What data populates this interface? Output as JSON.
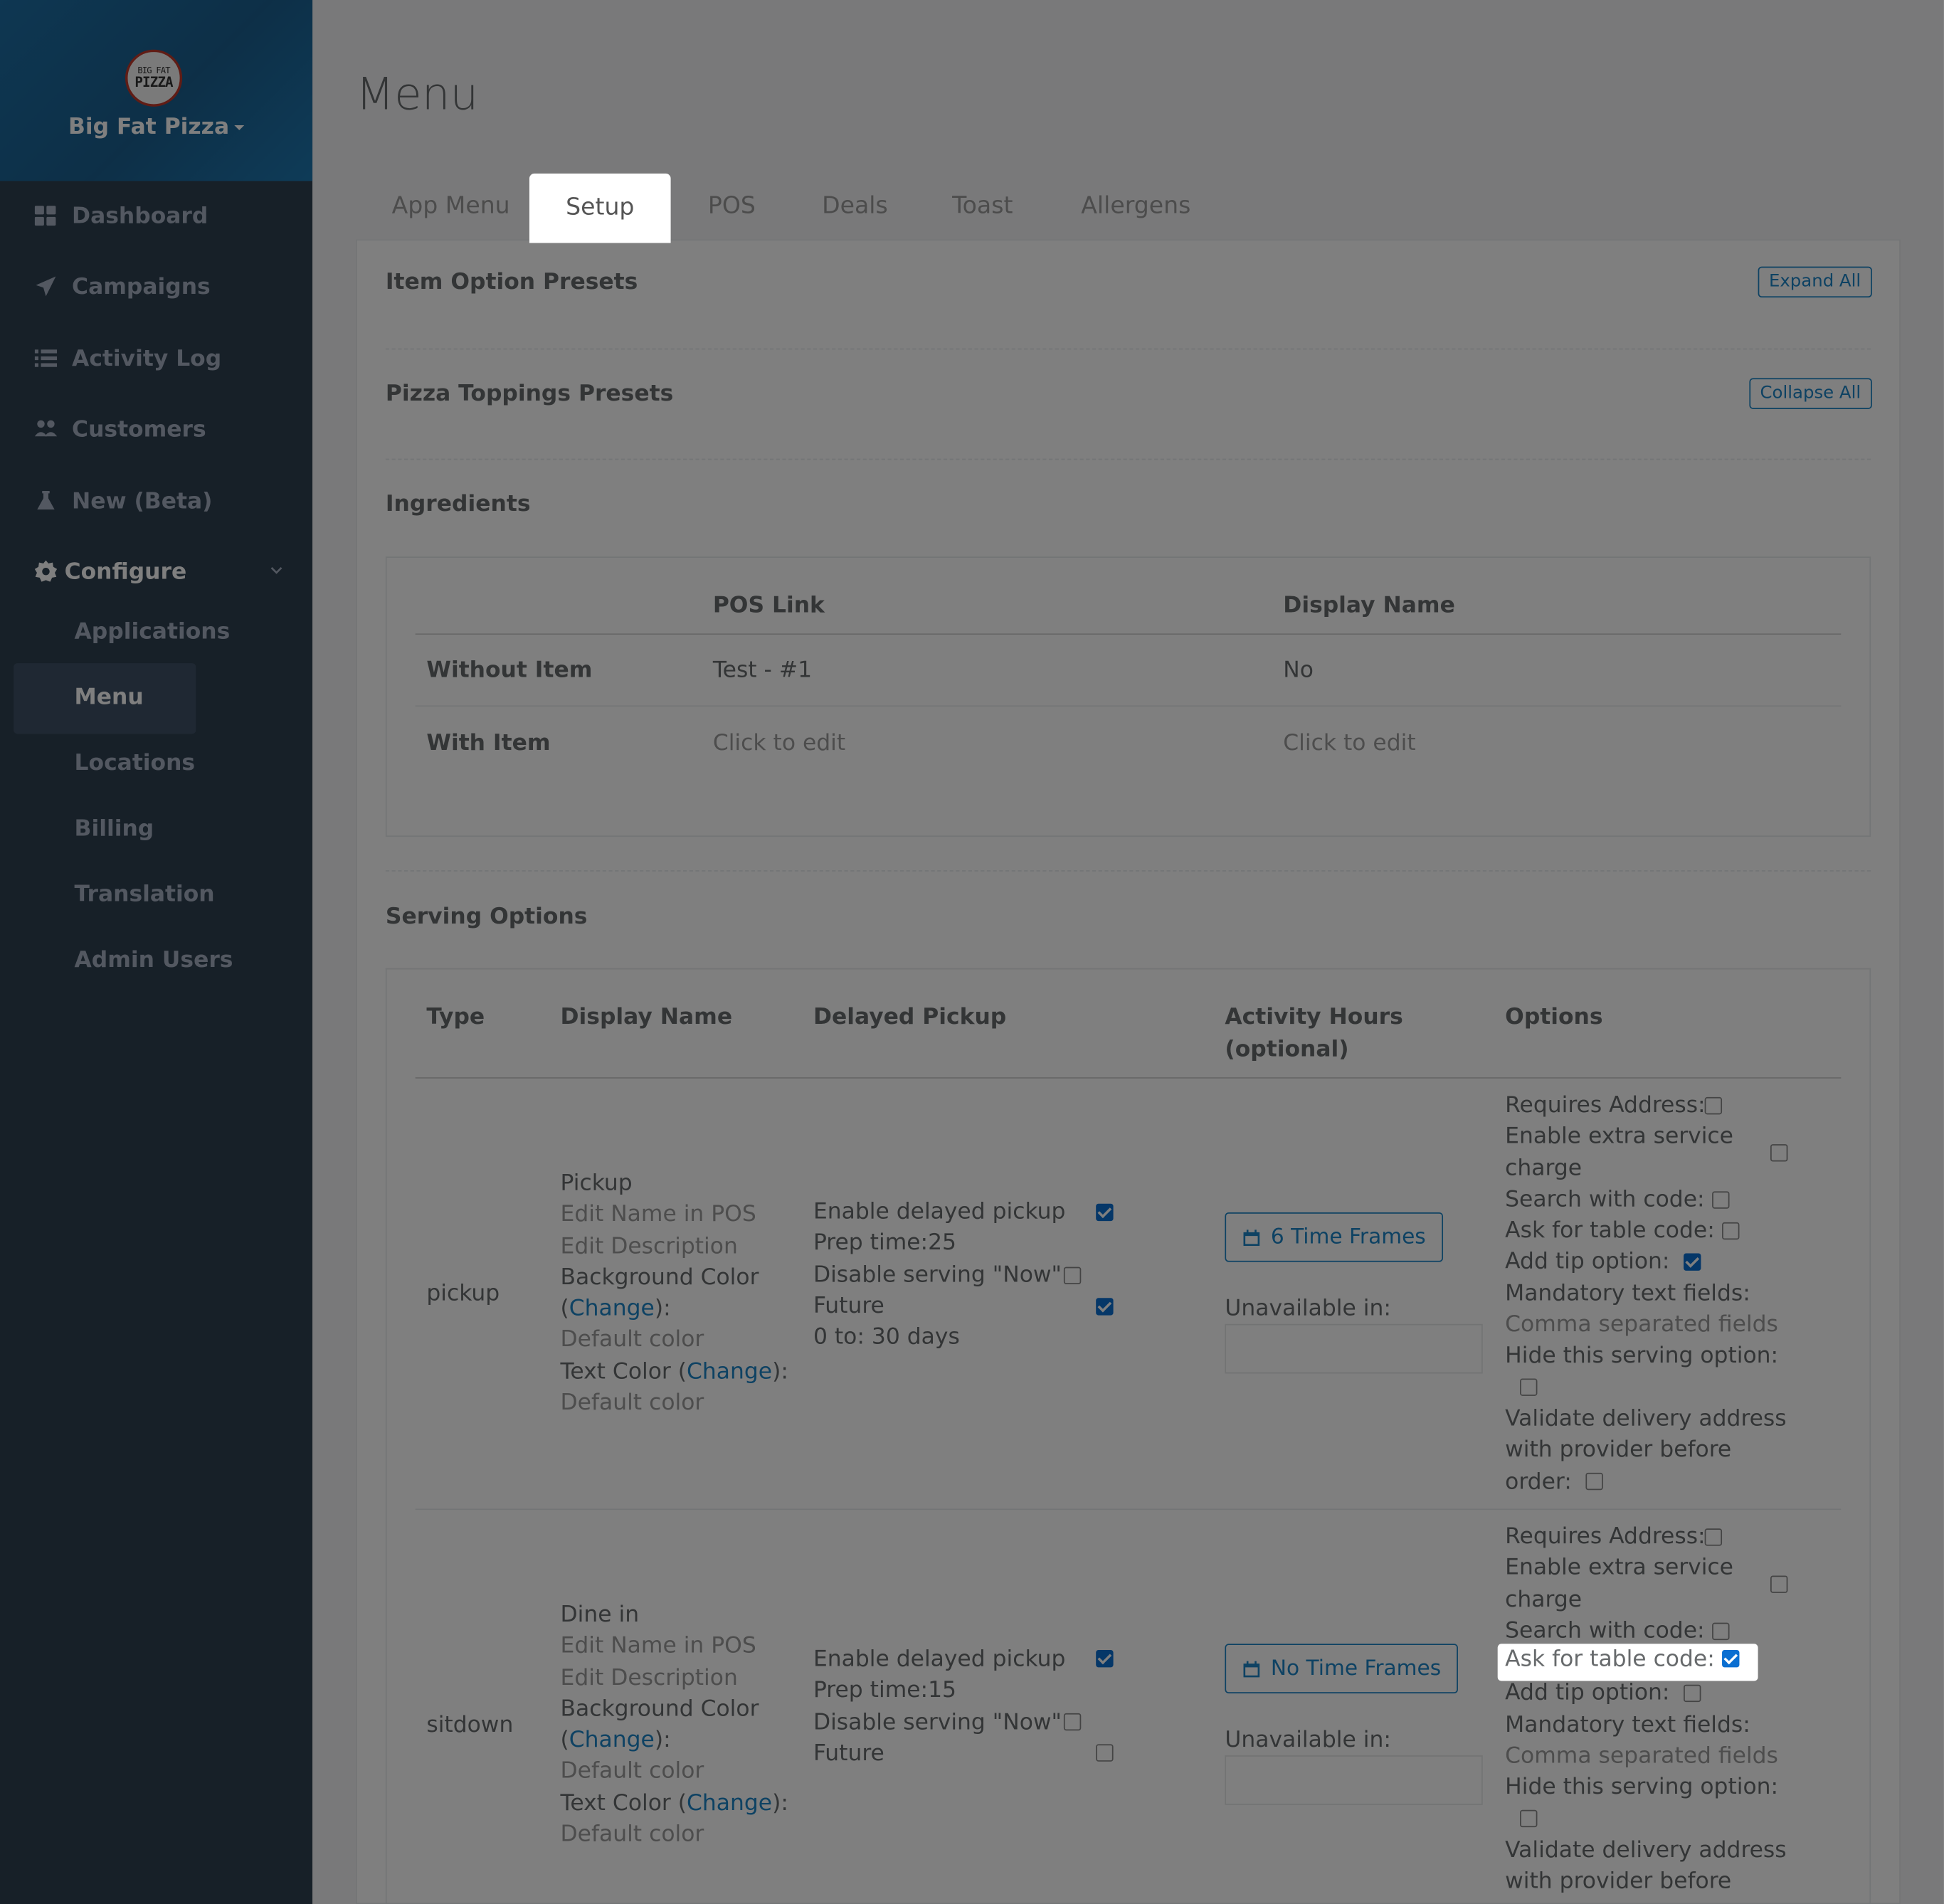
{
  "brand": {
    "logo_line1": "BIG FAT",
    "logo_line2": "PIZZA",
    "name": "Big Fat Pizza"
  },
  "nav": [
    {
      "label": "Dashboard",
      "icon": "dashboard-icon"
    },
    {
      "label": "Campaigns",
      "icon": "paper-plane-icon"
    },
    {
      "label": "Activity Log",
      "icon": "list-icon"
    },
    {
      "label": "Customers",
      "icon": "users-icon"
    },
    {
      "label": "New (Beta)",
      "icon": "flask-icon"
    },
    {
      "label": "Configure",
      "icon": "gear-icon"
    }
  ],
  "configure_sub": [
    "Applications",
    "Menu",
    "Locations",
    "Billing",
    "Translation",
    "Admin Users"
  ],
  "page_title": "Menu",
  "tabs": [
    "App Menu",
    "Setup",
    "POS",
    "Deals",
    "Toast",
    "Allergens"
  ],
  "active_tab": "Setup",
  "sections": {
    "item_option_presets": "Item Option Presets",
    "pizza_toppings_presets": "Pizza Toppings Presets",
    "ingredients": "Ingredients",
    "serving_options": "Serving Options"
  },
  "buttons": {
    "expand_all": "Expand All",
    "collapse_all": "Collapse All"
  },
  "ingredients": {
    "headers": {
      "pos_link": "POS Link",
      "display_name": "Display Name"
    },
    "rows": [
      {
        "label": "Without Item",
        "pos_link": "Test - #1",
        "display_name": "No"
      },
      {
        "label": "With Item",
        "pos_link": "Click to edit",
        "display_name": "Click to edit"
      }
    ]
  },
  "serving": {
    "headers": {
      "type": "Type",
      "display_name": "Display Name",
      "delayed_pickup": "Delayed Pickup",
      "activity_hours_1": "Activity Hours",
      "activity_hours_2": "(optional)",
      "options": "Options"
    },
    "labels": {
      "edit_name_pos": "Edit Name in POS",
      "edit_description": "Edit Description",
      "bg_color_1": "Background Color",
      "paren_open": "(",
      "change": "Change",
      "paren_close_colon": "):",
      "default_color": "Default color",
      "text_color": "Text Color (",
      "enable_delayed": "Enable delayed pickup",
      "disable_now": "Disable serving \"Now\"",
      "future": "Future",
      "unavailable_in": "Unavailable in:",
      "requires_address": "Requires Address:",
      "extra_charge_1": "Enable extra service",
      "extra_charge_2": "charge",
      "search_with_code": "Search with code:",
      "ask_table_code": "Ask for table code:",
      "add_tip": "Add tip option:",
      "mandatory_fields": "Mandatory text fields:",
      "comma_fields": "Comma separated fields",
      "hide_option": "Hide this serving option:",
      "validate_1": "Validate delivery address",
      "validate_2": "with provider before",
      "validate_3": "order:"
    },
    "rows": [
      {
        "type": "pickup",
        "display_name": "Pickup",
        "prep_time": "Prep time:25",
        "future_range": "0 to: 30 days",
        "time_frames": "6 Time Frames",
        "enable_delayed": true,
        "disable_now": false,
        "future": true,
        "requires_address": false,
        "extra_charge": false,
        "search_with_code": false,
        "ask_table_code": false,
        "add_tip": true,
        "hide_option": false,
        "validate": false
      },
      {
        "type": "sitdown",
        "display_name": "Dine in",
        "prep_time": "Prep time:15",
        "time_frames": "No Time Frames",
        "enable_delayed": true,
        "disable_now": false,
        "future": false,
        "requires_address": false,
        "extra_charge": false,
        "search_with_code": false,
        "ask_table_code": true,
        "add_tip": false,
        "hide_option": false,
        "validate": false
      }
    ]
  },
  "colors": {
    "accent": "#1c84c6",
    "sidebar": "#2f4050",
    "checkbox_on": "#0b6fd1"
  }
}
